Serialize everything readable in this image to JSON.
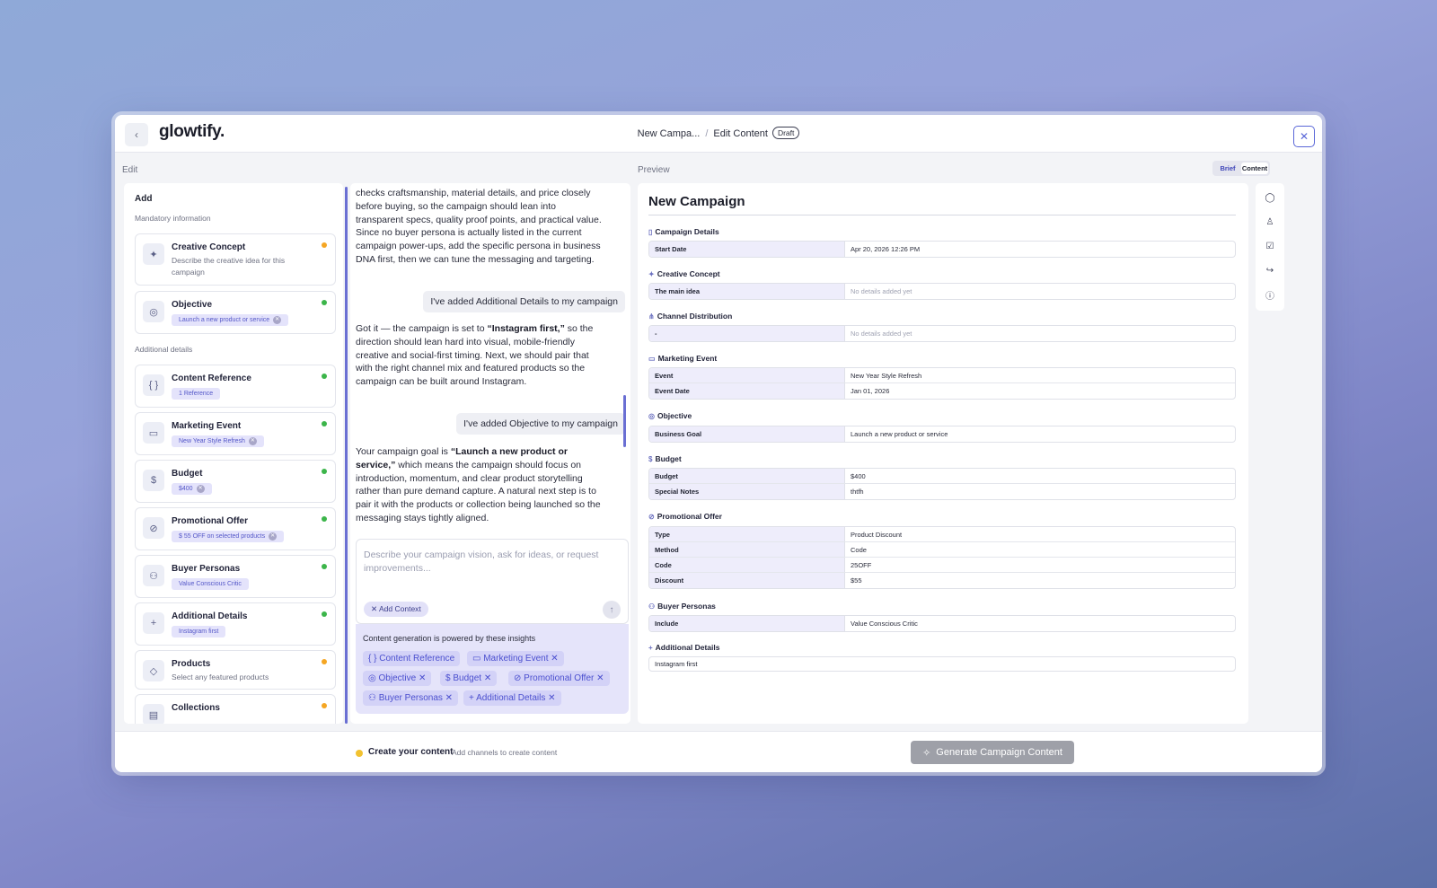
{
  "header": {
    "logo": "glowtify.",
    "crumb1": "New Campa...",
    "sep": "/",
    "crumb2": "Edit Content",
    "status": "Draft",
    "back_icon": "‹",
    "close_icon": "✕"
  },
  "labels": {
    "edit": "Edit",
    "preview": "Preview"
  },
  "toggle": {
    "brief": "Brief",
    "content": "Content"
  },
  "left": {
    "add": "Add",
    "mandatory": "Mandatory information",
    "additional": "Additional details",
    "items": [
      {
        "title": "Creative Concept",
        "desc": "Describe the creative idea for this campaign",
        "status": "pending"
      },
      {
        "title": "Objective",
        "chip": "Launch a new product or service",
        "status": "done"
      },
      {
        "title": "Content Reference",
        "chip": "1 Reference",
        "status": "done"
      },
      {
        "title": "Marketing Event",
        "chip": "New Year Style Refresh",
        "status": "done"
      },
      {
        "title": "Budget",
        "chip": "$400",
        "status": "done"
      },
      {
        "title": "Promotional Offer",
        "chip": "$ 55 OFF on selected products",
        "status": "done"
      },
      {
        "title": "Buyer Personas",
        "chip": "Value Conscious Critic",
        "status": "done"
      },
      {
        "title": "Additional Details",
        "chip": "Instagram first",
        "status": "done"
      },
      {
        "title": "Products",
        "desc": "Select any featured products",
        "status": "pending"
      },
      {
        "title": "Collections",
        "status": "pending"
      }
    ]
  },
  "chat": {
    "m1": "checks craftsmanship, material details, and price closely before buying, so the campaign should lean into transparent specs, quality proof points, and practical value. Since no buyer persona is actually listed in the current campaign power-ups, add the specific persona in business DNA first, then we can tune the messaging and targeting.",
    "u1": "I've added Additional Details to my campaign",
    "m2a": "Got it — the campaign is set to ",
    "m2b": "“Instagram first,”",
    "m2c": " so the direction should lean hard into visual, mobile-friendly creative and social-first timing. Next, we should pair that with the right channel mix and featured products so the campaign can be built around Instagram.",
    "u2": "I've added Objective to my campaign",
    "m3a": "Your campaign goal is ",
    "m3b": "“Launch a new product or service,”",
    "m3c": " which means the campaign should focus on introduction, momentum, and clear product storytelling rather than pure demand capture. A natural next step is to pair it with the products or collection being launched so the messaging stays tightly aligned.",
    "placeholder": "Describe your campaign vision, ask for ideas, or request improvements...",
    "add_context": "✕  Add Context",
    "send_icon": "↑",
    "insights_title": "Content generation is powered by these insights",
    "insights": [
      "{ } Content Reference",
      "▭ Marketing Event ✕",
      "◎ Objective ✕",
      "$ Budget ✕",
      "⊘ Promotional Offer ✕",
      "⚇ Buyer Personas ✕",
      "+ Additional Details ✕"
    ]
  },
  "preview": {
    "title": "New Campaign",
    "sections": {
      "campaign_details": "Campaign Details",
      "creative_concept": "Creative Concept",
      "channel_distribution": "Channel Distribution",
      "marketing_event": "Marketing Event",
      "objective": "Objective",
      "budget": "Budget",
      "promotional_offer": "Promotional Offer",
      "buyer_personas": "Buyer Personas",
      "additional_details": "Additional Details"
    },
    "rows": {
      "start_date": [
        "Start Date",
        "Apr 20, 2026 12:26 PM"
      ],
      "main_idea": [
        "The main idea",
        "No details added yet"
      ],
      "channel": [
        "-",
        "No details added yet"
      ],
      "event": [
        "Event",
        "New Year Style Refresh"
      ],
      "event_date": [
        "Event Date",
        "Jan 01, 2026"
      ],
      "business_goal": [
        "Business Goal",
        "Launch a new product or service"
      ],
      "budget": [
        "Budget",
        "$400"
      ],
      "special_notes": [
        "Special Notes",
        "thtfh"
      ],
      "type": [
        "Type",
        "Product Discount"
      ],
      "method": [
        "Method",
        "Code"
      ],
      "code": [
        "Code",
        "25OFF"
      ],
      "discount": [
        "Discount",
        "$55"
      ],
      "include": [
        "Include",
        "Value Conscious Critic"
      ],
      "additional": "Instagram first"
    }
  },
  "bottom": {
    "title": "Create your content",
    "sub": "Add channels to create content",
    "generate": "Generate Campaign Content"
  },
  "colors": {
    "accent": "#5a67d8",
    "done": "#3cb54a",
    "pending": "#f5a623",
    "chip_bg": "#e4e3fb"
  }
}
